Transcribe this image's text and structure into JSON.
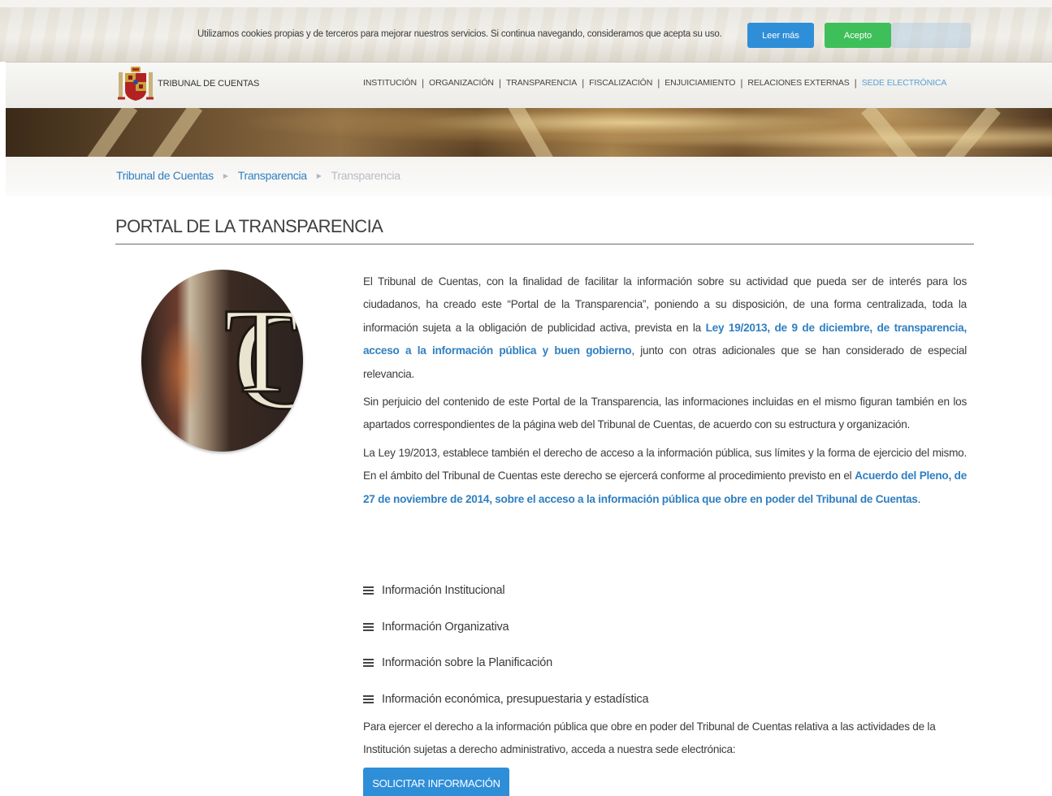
{
  "cookie": {
    "text": "Utilizamos cookies propias y de terceros para mejorar nuestros servicios. Si continua navegando, consideramos que acepta su uso.",
    "read_more_label": "Leer más",
    "accept_label": "Acepto"
  },
  "header": {
    "logo_text": "TRIBUNAL DE CUENTAS",
    "nav": [
      "INSTITUCIÓN",
      "ORGANIZACIÓN",
      "TRANSPARENCIA",
      "FISCALIZACIÓN",
      "ENJUICIAMIENTO",
      "RELACIONES EXTERNAS",
      "SEDE ELECTRÓNICA"
    ],
    "separator": "|"
  },
  "breadcrumb": {
    "items": [
      "Tribunal de Cuentas",
      "Transparencia",
      "Transparencia"
    ]
  },
  "page": {
    "title": "PORTAL DE LA TRANSPARENCIA",
    "emblem_letters": "TC",
    "p1": {
      "before": "El Tribunal de Cuentas, con la finalidad de facilitar la información sobre su actividad que pueda ser de interés para los ciudadanos, ha creado este “Portal de la Transparencia”, poniendo a su disposición, de una forma centralizada, toda la información sujeta a la obligación de publicidad activa, prevista en la ",
      "link": "Ley 19/2013, de 9 de diciembre, de transparencia, acceso a la información pública y buen gobierno",
      "after": ", junto con otras adicionales que se han considerado de especial relevancia."
    },
    "p2": "Sin perjuicio del contenido de este Portal de la Transparencia, las informaciones incluidas en el mismo figuran también en los apartados correspondientes de la página web del Tribunal de Cuentas, de acuerdo con su estructura y organización.",
    "p3": {
      "before": "La Ley 19/2013, establece también el derecho de acceso a la información pública, sus límites y la forma de ejercicio del mismo. En el ámbito del Tribunal de Cuentas este derecho se ejercerá conforme al procedimiento previsto en el ",
      "link": "Acuerdo del Pleno, de 27 de noviembre de 2014, sobre el acceso a la información pública que obre en poder del Tribunal de Cuentas",
      "after": "."
    },
    "menu": [
      "Información Institucional",
      "Información Organizativa",
      "Información sobre la Planificación",
      "Información económica, presupuestaria y estadística"
    ],
    "footer_text": "Para ejercer el derecho a la información pública que obre en poder del Tribunal de Cuentas relativa a las actividades de la Institución sujetas a derecho administrativo, acceda a nuestra sede electrónica:",
    "request_button": "SOLICITAR INFORMACIÓN"
  },
  "colors": {
    "link": "#2f7fc1",
    "read_more_button": "#2f8ed8",
    "accept_button": "#3fbf5a",
    "nav_highlight": "#5aa0d6"
  }
}
